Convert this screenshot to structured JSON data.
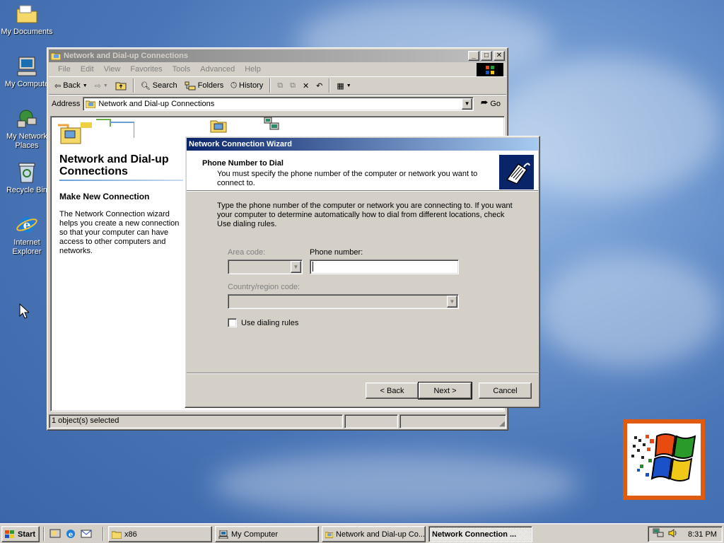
{
  "colors": {
    "desktop": "#4a76b8",
    "active_title": "#0a246a",
    "inactive_title": "#808080",
    "face": "#d4d0c8"
  },
  "desktop_icons": [
    {
      "label": "My Documents",
      "icon": "folder-icon"
    },
    {
      "label": "My Compute",
      "icon": "computer-icon"
    },
    {
      "label": "My Network Places",
      "icon": "network-places-icon"
    },
    {
      "label": "Recycle Bin",
      "icon": "recycle-bin-icon"
    },
    {
      "label": "Internet Explorer",
      "icon": "ie-icon"
    }
  ],
  "explorer": {
    "title": "Network and Dial-up Connections",
    "menu": [
      "File",
      "Edit",
      "View",
      "Favorites",
      "Tools",
      "Advanced",
      "Help"
    ],
    "toolbar": {
      "back": "Back",
      "search": "Search",
      "folders": "Folders",
      "history": "History"
    },
    "address_label": "Address",
    "address_value": "Network and Dial-up Connections",
    "go": "Go",
    "panel_title": "Network and Dial-up Connections",
    "panel_subtitle": "Make New Connection",
    "panel_desc": "The Network Connection wizard helps you create a new connection so that your computer can have access to other computers and networks.",
    "status": "1 object(s) selected"
  },
  "wizard": {
    "title": "Network Connection Wizard",
    "header_title": "Phone Number to Dial",
    "header_sub": "You must specify the phone number of the computer or network you want to connect to.",
    "intro": "Type the phone number of the computer or network you are connecting to. If you want your computer to determine automatically how to dial from different locations, check Use dialing rules.",
    "area_code_label": "Area code:",
    "area_code_value": "",
    "phone_label": "Phone number:",
    "phone_value": "",
    "country_label": "Country/region code:",
    "country_value": "",
    "dialing_rules_label": "Use dialing rules",
    "dialing_rules_checked": false,
    "back": "< Back",
    "next": "Next >",
    "cancel": "Cancel"
  },
  "taskbar": {
    "start": "Start",
    "tasks": [
      "x86",
      "My Computer",
      "Network and Dial-up Co...",
      "Network Connection ..."
    ],
    "clock": "8:31 PM"
  }
}
